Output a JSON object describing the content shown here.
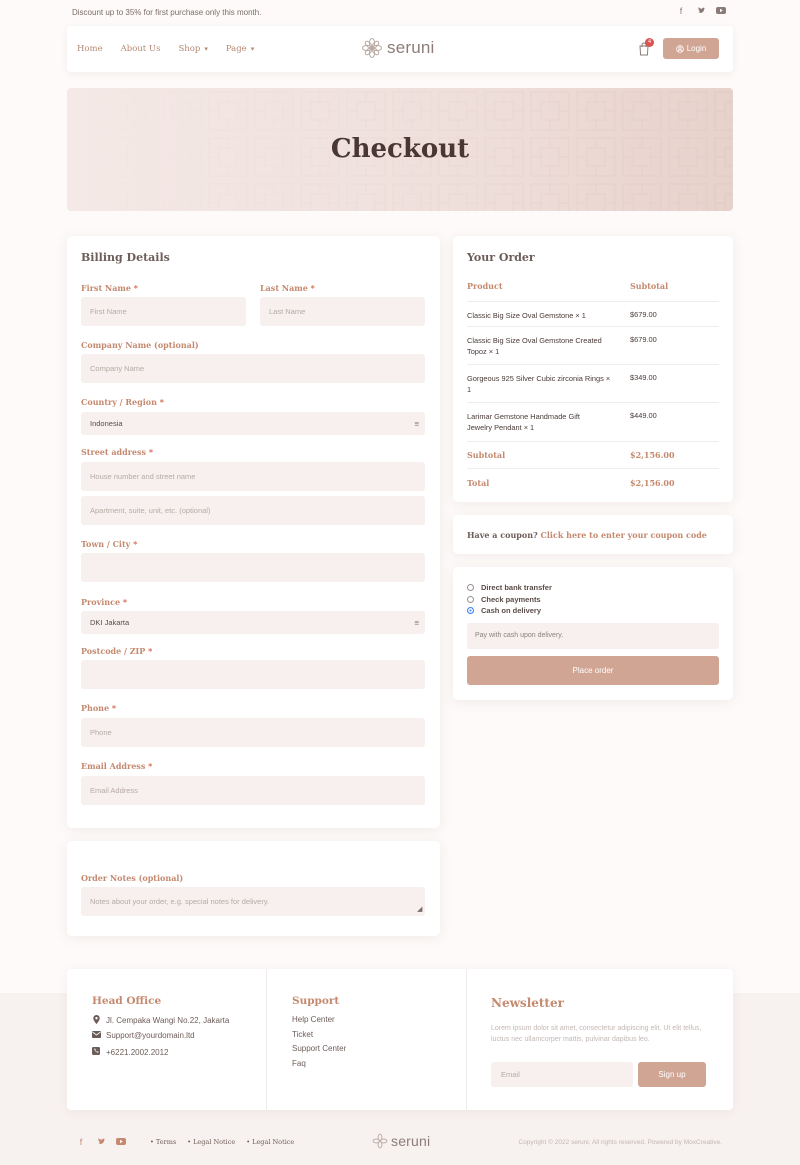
{
  "topbar": {
    "promo": "Discount up to 35% for first purchase only this month.",
    "socials": [
      "facebook-icon",
      "twitter-icon",
      "youtube-icon"
    ]
  },
  "header": {
    "nav": [
      {
        "label": "Home",
        "dropdown": false
      },
      {
        "label": "About Us",
        "dropdown": false
      },
      {
        "label": "Shop",
        "dropdown": true
      },
      {
        "label": "Page",
        "dropdown": true
      }
    ],
    "logo": "seruni",
    "cart_count": "4",
    "login_label": "Login"
  },
  "hero": {
    "title": "Checkout"
  },
  "billing": {
    "title": "Billing Details",
    "first_name": {
      "label": "First Name",
      "placeholder": "First Name",
      "required": "*"
    },
    "last_name": {
      "label": "Last Name",
      "placeholder": "Last Name",
      "required": "*"
    },
    "company": {
      "label": "Company Name (optional)",
      "placeholder": "Company Name"
    },
    "country": {
      "label": "Country / Region",
      "value": "Indonesia",
      "required": "*"
    },
    "street": {
      "label": "Street address",
      "placeholder": "House number and street name",
      "placeholder2": "Apartment, suite, unit, etc. (optional)",
      "required": "*"
    },
    "town": {
      "label": "Town / City",
      "required": "*"
    },
    "province": {
      "label": "Province",
      "value": "DKI Jakarta",
      "required": "*"
    },
    "postcode": {
      "label": "Postcode / ZIP",
      "required": "*"
    },
    "phone": {
      "label": "Phone",
      "placeholder": "Phone",
      "required": "*"
    },
    "email": {
      "label": "Email Address",
      "placeholder": "Email Address",
      "required": "*"
    }
  },
  "notes": {
    "label": "Order Notes (optional)",
    "placeholder": "Notes about your order, e.g. special notes for delivery."
  },
  "order": {
    "title": "Your Order",
    "col_product": "Product",
    "col_subtotal": "Subtotal",
    "items": [
      {
        "name": "Classic Big Size Oval Gemstone  × 1",
        "price": "$679.00"
      },
      {
        "name": "Classic Big Size Oval Gemstone Created Topoz  × 1",
        "price": "$679.00"
      },
      {
        "name": "Gorgeous 925 Silver Cubic zirconia Rings  × 1",
        "price": "$349.00"
      },
      {
        "name": "Larimar Gemstone Handmade Gift Jewelry Pendant  × 1",
        "price": "$449.00"
      }
    ],
    "subtotal_label": "Subtotal",
    "subtotal": "$2,156.00",
    "total_label": "Total",
    "total": "$2,156.00"
  },
  "coupon": {
    "prefix": "Have a coupon?",
    "link": "Click here to enter your coupon code"
  },
  "payment": {
    "options": [
      "Direct bank transfer",
      "Check payments",
      "Cash on delivery"
    ],
    "selected": 2,
    "description": "Pay with cash upon delivery.",
    "place_order": "Place order"
  },
  "footer": {
    "head_office": {
      "title": "Head Office",
      "address": "Jl. Cempaka Wangi No.22, Jakarta",
      "email": "Support@yourdomain.ltd",
      "phone": "+6221.2002.2012"
    },
    "support": {
      "title": "Support",
      "links": [
        "Help Center",
        "Ticket",
        "Support Center",
        "Faq"
      ]
    },
    "newsletter": {
      "title": "Newsletter",
      "text": "Lorem ipsum dolor sit amet, consectetur adipiscing elit. Ut elit tellus, luctus nec ullamcorper mattis, pulvinar dapibus leo.",
      "placeholder": "Email",
      "button": "Sign up"
    }
  },
  "bottom": {
    "links": [
      "Terms",
      "Legal Notice",
      "Legal Notice"
    ],
    "logo": "seruni",
    "copyright": "Copyright © 2022 seruni, All rights reserved. Powered by MoxCreative."
  },
  "colors": {
    "accent": "#d1a594",
    "label": "#c4896f",
    "field_bg": "#f7f0ee",
    "page_bg": "#fdfaf9"
  }
}
